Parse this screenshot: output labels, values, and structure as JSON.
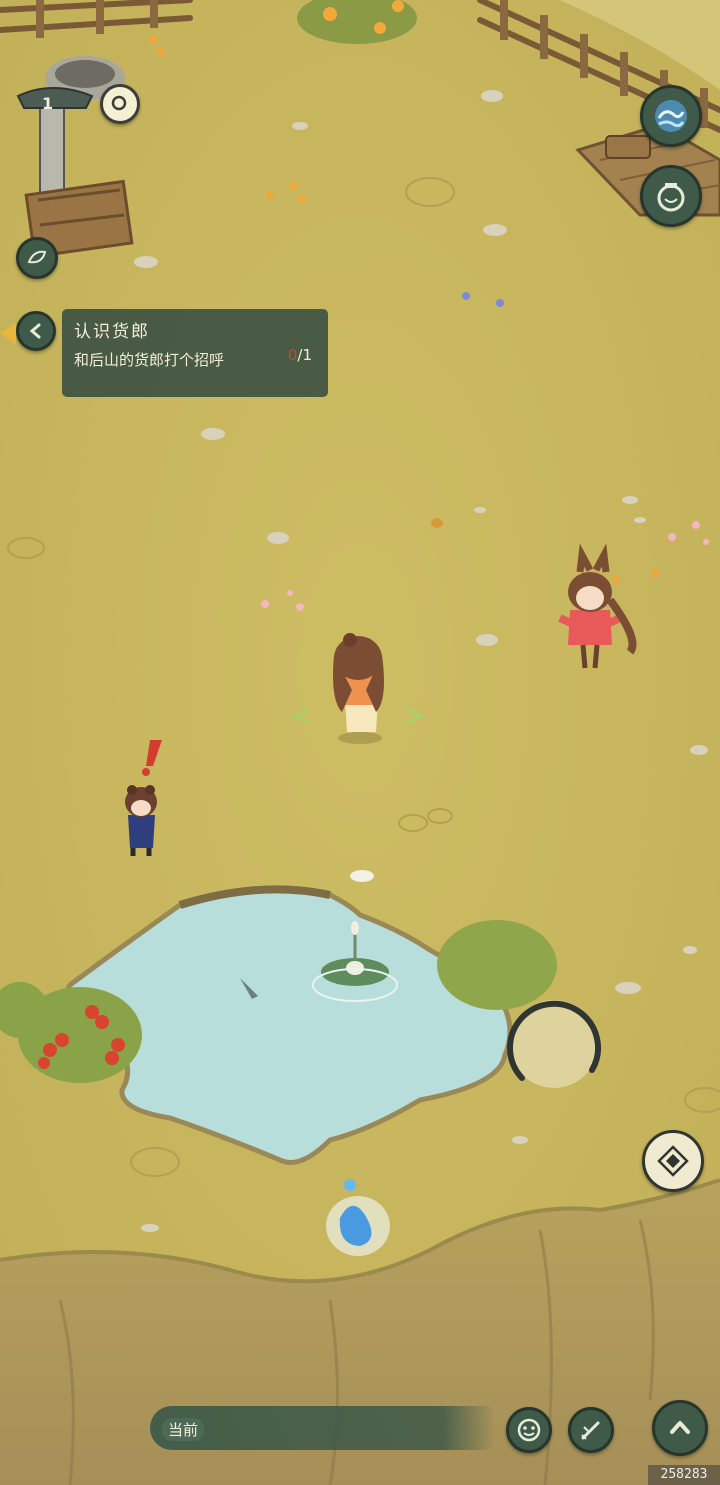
{
  "hud": {
    "level": "1",
    "player_id": "258283"
  },
  "quest": {
    "title": "认识货郎",
    "description": "和后山的货郎打个招呼",
    "progress_current": "0",
    "progress_total": "/1"
  },
  "chat": {
    "channel_label": "当前"
  },
  "colors": {
    "grass": "#c9b960",
    "water": "#b7dcd8",
    "button": "#3f5a48",
    "panel": "#3e5242",
    "alert": "#d63b2f"
  },
  "icons": [
    "wave-icon",
    "jar-icon",
    "leaf-icon",
    "back-arrow-icon",
    "joystick",
    "compass-icon",
    "emote-icon",
    "quill-icon",
    "expand-up-icon"
  ]
}
